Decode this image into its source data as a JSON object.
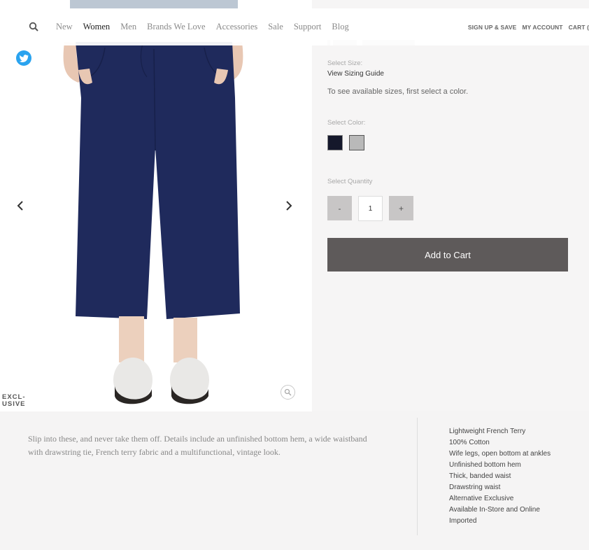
{
  "nav": {
    "links": [
      "New",
      "Women",
      "Men",
      "Brands We Love",
      "Accessories",
      "Sale",
      "Support",
      "Blog"
    ],
    "active": "Women",
    "sign_up": "SIGN UP & SAVE",
    "account": "MY ACCOUNT",
    "cart": "CART ("
  },
  "product": {
    "select_size_label": "Select Size:",
    "sizing_guide": "View Sizing Guide",
    "size_note": "To see available sizes, first select a color.",
    "select_color_label": "Select Color:",
    "colors": [
      "#15182b",
      "#b9b9b9"
    ],
    "select_quantity_label": "Select Quantity",
    "qty_minus": "-",
    "qty_value": "1",
    "qty_plus": "+",
    "add_to_cart": "Add to Cart",
    "badge": "EXCL-\nUSIVE"
  },
  "colors": {
    "accent_button": "#5e5a5a",
    "twitter": "#2aa3ef",
    "pants": "#1f2a5c"
  },
  "details": {
    "description": "Slip into these, and never take them off. Details include an unfinished bottom hem, a wide waistband with drawstring tie, French terry fabric and a multifunctional, vintage look.",
    "features": [
      "Lightweight French Terry",
      "100% Cotton",
      "Wife legs, open bottom at ankles",
      "Unfinished bottom hem",
      "Thick, banded waist",
      "Drawstring waist",
      "Alternative Exclusive",
      "Available In-Store and Online",
      "Imported"
    ]
  }
}
